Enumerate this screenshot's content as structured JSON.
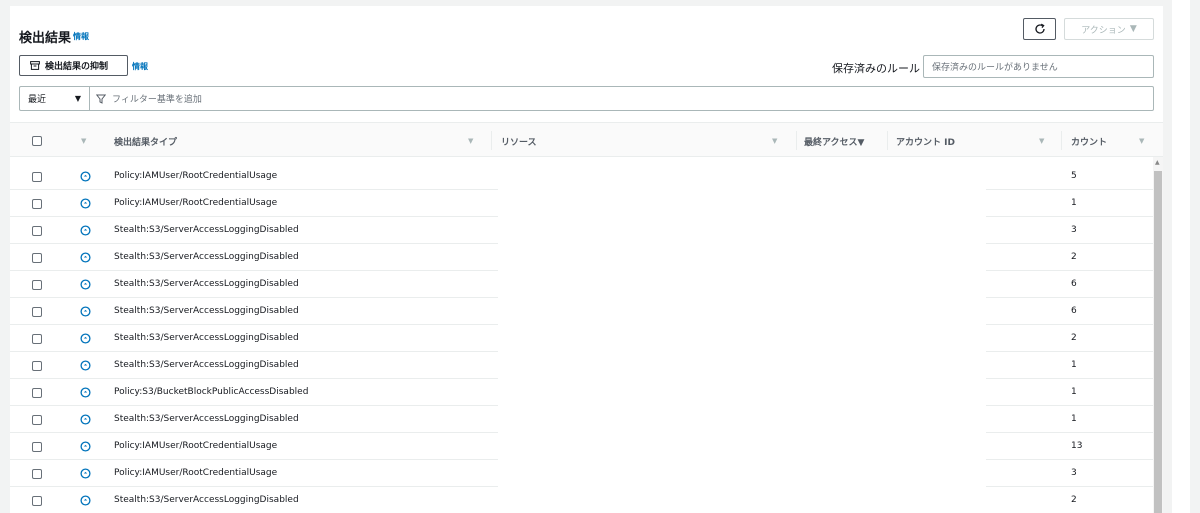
{
  "header": {
    "title": "検出結果",
    "info_label": "情報",
    "action_label": "アクション"
  },
  "toolbar": {
    "suppress_label": "検出結果の抑制",
    "suppress_info": "情報",
    "saved_rules_label": "保存済みのルール",
    "saved_rules_placeholder": "保存済みのルールがありません"
  },
  "filter": {
    "time_select": "最近",
    "placeholder": "フィルター基準を追加"
  },
  "table": {
    "headers": {
      "type": "検出結果タイプ",
      "resource": "リソース",
      "last_access": "最終アクセス▼",
      "account_id": "アカウント ID",
      "count": "カウント"
    },
    "rows": [
      {
        "type": "Policy:IAMUser/RootCredentialUsage",
        "count": "5"
      },
      {
        "type": "Policy:IAMUser/RootCredentialUsage",
        "count": "1"
      },
      {
        "type": "Stealth:S3/ServerAccessLoggingDisabled",
        "count": "3"
      },
      {
        "type": "Stealth:S3/ServerAccessLoggingDisabled",
        "count": "2"
      },
      {
        "type": "Stealth:S3/ServerAccessLoggingDisabled",
        "count": "6"
      },
      {
        "type": "Stealth:S3/ServerAccessLoggingDisabled",
        "count": "6"
      },
      {
        "type": "Stealth:S3/ServerAccessLoggingDisabled",
        "count": "2"
      },
      {
        "type": "Stealth:S3/ServerAccessLoggingDisabled",
        "count": "1"
      },
      {
        "type": "Policy:S3/BucketBlockPublicAccessDisabled",
        "count": "1"
      },
      {
        "type": "Stealth:S3/ServerAccessLoggingDisabled",
        "count": "1"
      },
      {
        "type": "Policy:IAMUser/RootCredentialUsage",
        "count": "13"
      },
      {
        "type": "Policy:IAMUser/RootCredentialUsage",
        "count": "3"
      },
      {
        "type": "Stealth:S3/ServerAccessLoggingDisabled",
        "count": "2"
      }
    ]
  },
  "colors": {
    "info_link": "#0073bb",
    "severity_icon": "#0073bb"
  },
  "icons": {
    "refresh": "refresh-icon",
    "suppress": "archive-icon",
    "filter": "filter-icon",
    "severity": "severity-low-icon"
  }
}
